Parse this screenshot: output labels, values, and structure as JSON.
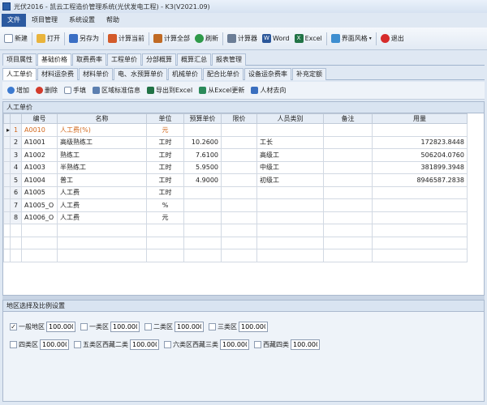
{
  "window": {
    "title": "光伏2016 - 凯云工程造价管理系统(光伏发电工程) - K3(V2021.09)"
  },
  "menu": [
    {
      "label": "文件",
      "active": true
    },
    {
      "label": "项目管理",
      "active": false
    },
    {
      "label": "系统设置",
      "active": false
    },
    {
      "label": "帮助",
      "active": false
    }
  ],
  "toolbar": {
    "new": "新建",
    "open": "打开",
    "save_as": "另存为",
    "calc_current": "计算当前",
    "calc_all": "计算全部",
    "refresh": "刷新",
    "calculator": "计算器",
    "word": "Word",
    "excel": "Excel",
    "theme": "界面风格",
    "exit": "退出",
    "word_icon": "W",
    "excel_icon": "X"
  },
  "tabs1": [
    "项目属性",
    "基础价格",
    "取费费率",
    "工程单价",
    "分部概算",
    "概算汇总",
    "报表管理"
  ],
  "tabs1_active": 1,
  "tabs2": [
    "人工单价",
    "材料运杂费",
    "材料单价",
    "电、水预算单价",
    "机械单价",
    "配合比单价",
    "设备运杂费率",
    "补充定额"
  ],
  "tabs2_active": 0,
  "subtoolbar": {
    "add": "增加",
    "delete": "删除",
    "manual": "手填",
    "region_info": "区域标准信息",
    "export_excel": "导出到Excel",
    "import_excel": "从Excel更新",
    "labor_dest": "人材去向"
  },
  "panel1": {
    "title": "人工单价"
  },
  "table": {
    "headers": [
      "编号",
      "名称",
      "单位",
      "预算单价",
      "限价",
      "人员类别",
      "备注",
      "用量"
    ],
    "rows": [
      {
        "num": "1",
        "code": "A0010",
        "name": "人工费(%)",
        "unit": "元",
        "price": "",
        "limit": "",
        "category": "",
        "note": "",
        "qty": "",
        "highlight": true,
        "current": true
      },
      {
        "num": "2",
        "code": "A1001",
        "name": "高级熟练工",
        "unit": "工时",
        "price": "10.2600",
        "limit": "",
        "category": "工长",
        "note": "",
        "qty": "172823.8448"
      },
      {
        "num": "3",
        "code": "A1002",
        "name": "熟练工",
        "unit": "工时",
        "price": "7.6100",
        "limit": "",
        "category": "高级工",
        "note": "",
        "qty": "506204.0760"
      },
      {
        "num": "4",
        "code": "A1003",
        "name": "半熟练工",
        "unit": "工时",
        "price": "5.9500",
        "limit": "",
        "category": "中级工",
        "note": "",
        "qty": "381899.3948"
      },
      {
        "num": "5",
        "code": "A1004",
        "name": "普工",
        "unit": "工时",
        "price": "4.9000",
        "limit": "",
        "category": "初级工",
        "note": "",
        "qty": "8946587.2838"
      },
      {
        "num": "6",
        "code": "A1005",
        "name": "人工费",
        "unit": "工时",
        "price": "",
        "limit": "",
        "category": "",
        "note": "",
        "qty": ""
      },
      {
        "num": "7",
        "code": "A1005_O",
        "name": "人工费",
        "unit": "%",
        "price": "",
        "limit": "",
        "category": "",
        "note": "",
        "qty": ""
      },
      {
        "num": "8",
        "code": "A1006_O",
        "name": "人工费",
        "unit": "元",
        "price": "",
        "limit": "",
        "category": "",
        "note": "",
        "qty": ""
      }
    ]
  },
  "panel2": {
    "title": "地区选择及比例设置"
  },
  "regions_row1": [
    {
      "label": "一般地区",
      "value": "100.0000",
      "checked": true
    },
    {
      "label": "一类区",
      "value": "100.0000",
      "checked": false
    },
    {
      "label": "二类区",
      "value": "100.0000",
      "checked": false
    },
    {
      "label": "三类区",
      "value": "100.0000",
      "checked": false
    }
  ],
  "regions_row2": [
    {
      "label": "四类区",
      "value": "100.0000",
      "checked": false
    },
    {
      "label": "五类区西藏二类",
      "value": "100.0000",
      "checked": false
    },
    {
      "label": "六类区西藏三类",
      "value": "100.0000",
      "checked": false
    },
    {
      "label": "西藏四类",
      "value": "100.0000",
      "checked": false
    }
  ],
  "checkmark": "✓",
  "row_indicator": "▸"
}
